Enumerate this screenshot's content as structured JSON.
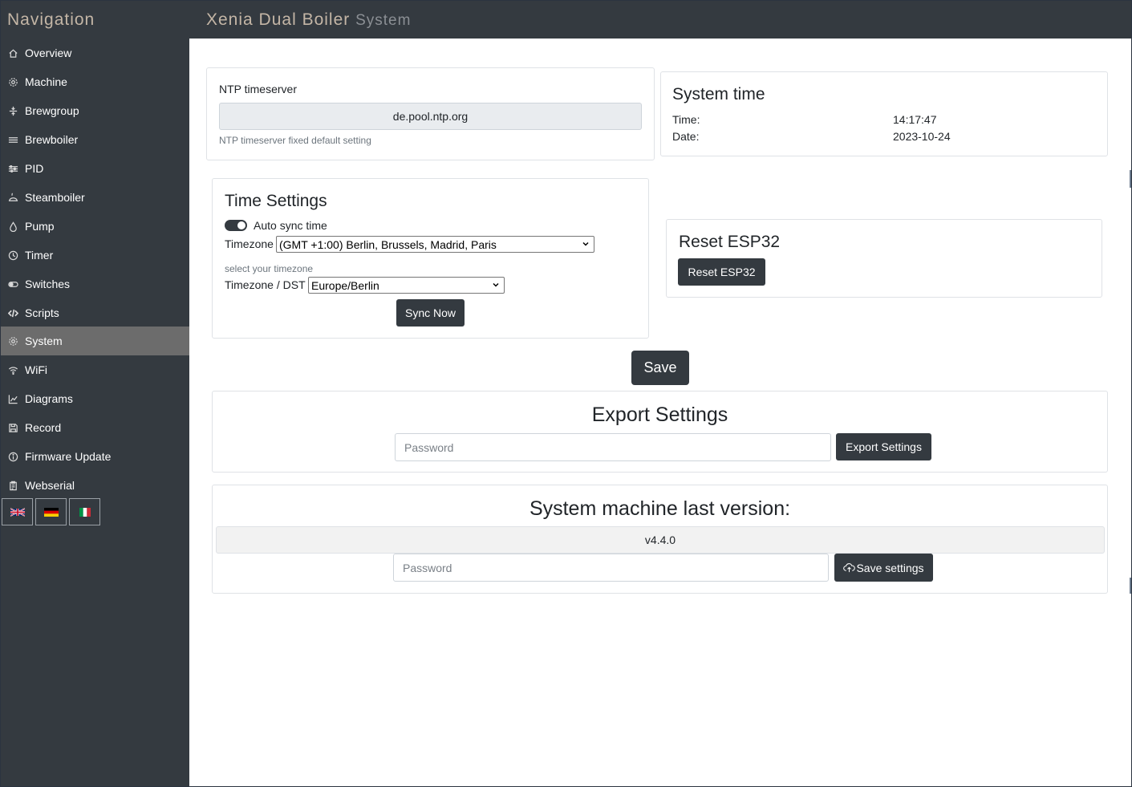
{
  "sidebar": {
    "title": "Navigation",
    "items": [
      {
        "label": "Overview",
        "icon": "home-icon"
      },
      {
        "label": "Machine",
        "icon": "gear-icon"
      },
      {
        "label": "Brewgroup",
        "icon": "brewgroup-icon"
      },
      {
        "label": "Brewboiler",
        "icon": "boiler-icon"
      },
      {
        "label": "PID",
        "icon": "sliders-icon"
      },
      {
        "label": "Steamboiler",
        "icon": "steam-icon"
      },
      {
        "label": "Pump",
        "icon": "droplet-icon"
      },
      {
        "label": "Timer",
        "icon": "clock-icon"
      },
      {
        "label": "Switches",
        "icon": "toggle-icon"
      },
      {
        "label": "Scripts",
        "icon": "code-icon"
      },
      {
        "label": "System",
        "icon": "gear-icon",
        "active": true
      },
      {
        "label": "WiFi",
        "icon": "wifi-icon"
      },
      {
        "label": "Diagrams",
        "icon": "chart-icon"
      },
      {
        "label": "Record",
        "icon": "save-icon"
      },
      {
        "label": "Firmware Update",
        "icon": "info-icon"
      },
      {
        "label": "Webserial",
        "icon": "clipboard-icon"
      }
    ],
    "languages": [
      "uk-flag-icon",
      "germany-flag-icon",
      "italy-flag-icon"
    ]
  },
  "header": {
    "title": "Xenia Dual Boiler",
    "subtitle": "System"
  },
  "ntp": {
    "label": "NTP timeserver",
    "value": "de.pool.ntp.org",
    "help": "NTP timeserver fixed default setting"
  },
  "system_time": {
    "title": "System time",
    "time_label": "Time:",
    "time_value": "14:17:47",
    "date_label": "Date:",
    "date_value": "2023-10-24"
  },
  "time_settings": {
    "title": "Time Settings",
    "auto_sync_label": "Auto sync time",
    "auto_sync_on": true,
    "timezone_label": "Timezone",
    "timezone_value": "(GMT +1:00) Berlin, Brussels, Madrid, Paris",
    "timezone_help": "select your timezone",
    "dst_label": "Timezone / DST",
    "dst_value": "Europe/Berlin",
    "sync_button": "Sync Now"
  },
  "reset": {
    "title": "Reset ESP32",
    "button": "Reset ESP32"
  },
  "save_button": "Save",
  "export": {
    "title": "Export Settings",
    "password_placeholder": "Password",
    "button": "Export Settings"
  },
  "version": {
    "title": "System machine last version:",
    "value": "v4.4.0",
    "password_placeholder": "Password",
    "button": "Save settings"
  },
  "colors": {
    "sidebar_bg": "#343a40",
    "active_item_bg": "#6c6c6c",
    "title_color": "#c4b6a6",
    "button_bg": "#343a40"
  }
}
